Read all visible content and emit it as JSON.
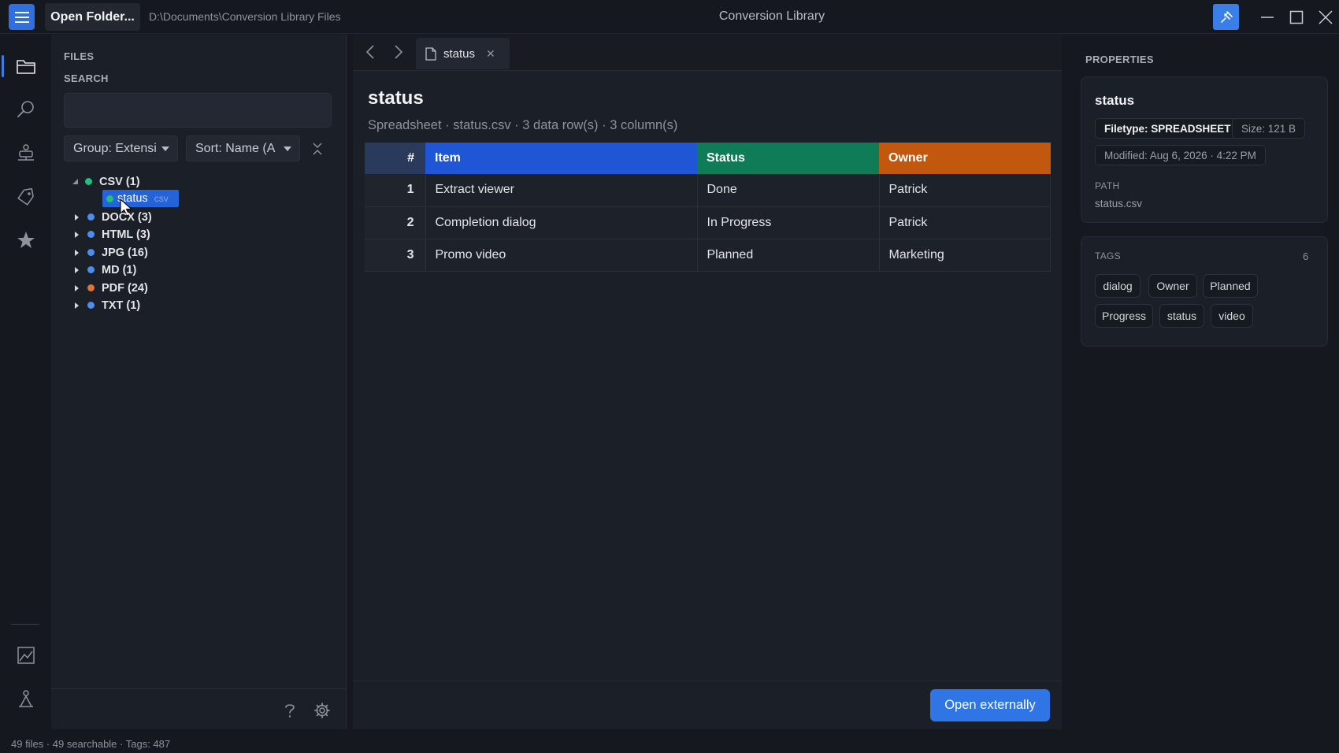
{
  "window": {
    "open_folder_label": "Open Folder...",
    "path": "D:\\Documents\\Conversion Library Files",
    "title": "Conversion Library",
    "accent_color": "#2f75e6"
  },
  "sidebar": {
    "files_label": "FILES",
    "search_label": "SEARCH",
    "search_value": "",
    "group_select": "Group: Extensi",
    "sort_select": "Sort: Name (A",
    "tree": [
      {
        "label": "CSV (1)",
        "color": "#22c07a",
        "expanded": true
      },
      {
        "label": "DOCX (3)",
        "color": "#4b8ef0",
        "expanded": false
      },
      {
        "label": "HTML (3)",
        "color": "#4b8ef0",
        "expanded": false
      },
      {
        "label": "JPG (16)",
        "color": "#4b8ef0",
        "expanded": false
      },
      {
        "label": "MD (1)",
        "color": "#4b8ef0",
        "expanded": false
      },
      {
        "label": "PDF (24)",
        "color": "#e0733a",
        "expanded": false
      },
      {
        "label": "TXT (1)",
        "color": "#4b8ef0",
        "expanded": false
      }
    ],
    "selected_file": {
      "label": "status",
      "ext": "csv",
      "color": "#22c07a"
    }
  },
  "editor": {
    "tab_label": "status",
    "doc_title": "status",
    "doc_meta": "Spreadsheet · status.csv · 3 data row(s) · 3 column(s)",
    "table": {
      "headers": [
        {
          "label": "#",
          "color": "#2a3a5c"
        },
        {
          "label": "Item",
          "color": "#1f56d6"
        },
        {
          "label": "Status",
          "color": "#0e7d57"
        },
        {
          "label": "Owner",
          "color": "#c2570e"
        }
      ],
      "rows": [
        [
          "1",
          "Extract viewer",
          "Done",
          "Patrick"
        ],
        [
          "2",
          "Completion dialog",
          "In Progress",
          "Patrick"
        ],
        [
          "3",
          "Promo video",
          "Planned",
          "Marketing"
        ]
      ]
    },
    "open_externally_label": "Open externally"
  },
  "properties": {
    "section_label": "PROPERTIES",
    "title": "status",
    "filetype": "Filetype: SPREADSHEET",
    "size": "Size: 121 B",
    "modified": "Modified: Aug 6, 2026 · 4:22 PM",
    "path_label": "PATH",
    "path_value": "status.csv",
    "tags_label": "TAGS",
    "tags_count": "6",
    "tags": [
      "dialog",
      "Owner",
      "Planned",
      "Progress",
      "status",
      "video"
    ]
  },
  "statusbar": {
    "text": "49 files · 49 searchable · Tags: 487"
  }
}
